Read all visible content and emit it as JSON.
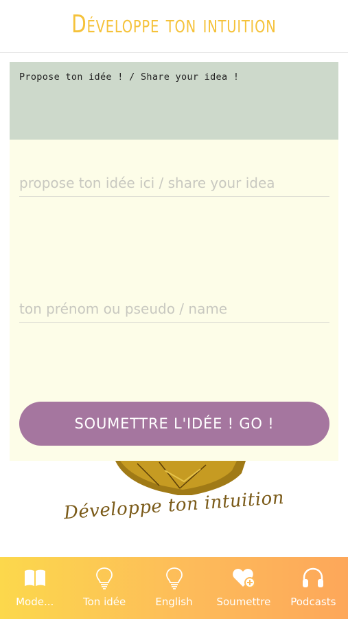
{
  "header": {
    "title": "Développe ton intuition"
  },
  "form": {
    "banner_text": "Propose ton idée ! / Share your idea !",
    "idea_placeholder": "propose ton idée ici / share your idea",
    "name_placeholder": "ton prénom ou pseudo / name",
    "submit_label": "SOUMETTRE L'IDÉE ! GO !"
  },
  "logo": {
    "signature_text": "Développe ton intuition"
  },
  "tabs": [
    {
      "label": "Mode...",
      "icon": "book-icon"
    },
    {
      "label": "Ton idée",
      "icon": "lightbulb-icon"
    },
    {
      "label": "English",
      "icon": "lightbulb-icon"
    },
    {
      "label": "Soumettre",
      "icon": "heart-plus-icon"
    },
    {
      "label": "Podcasts",
      "icon": "headphones-icon"
    }
  ],
  "colors": {
    "accent": "#f5c23a",
    "banner_bg": "#cdd9cb",
    "card_bg": "#fdfde8",
    "button": "#a5769f",
    "tabbar_start": "#fcd84c",
    "tabbar_end": "#fda75a"
  }
}
